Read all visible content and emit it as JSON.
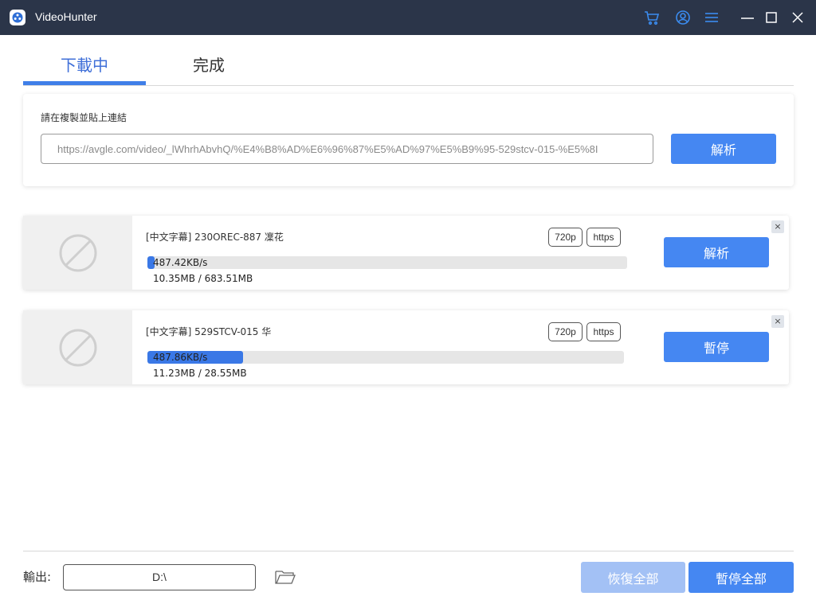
{
  "app": {
    "title": "VideoHunter",
    "icons": [
      "cart-icon",
      "account-icon",
      "menu-icon",
      "minimize-icon",
      "maximize-icon",
      "close-icon"
    ]
  },
  "tabs": [
    {
      "label": "下載中",
      "active": true
    },
    {
      "label": "完成",
      "active": false
    }
  ],
  "url_panel": {
    "label": "請在複製並貼上連結",
    "value": "https://avgle.com/video/_lWhrhAbvhQ/%E4%B8%AD%E6%96%87%E5%AD%97%E5%B9%95-529stcv-015-%E5%8I",
    "button": "解析"
  },
  "downloads": [
    {
      "title": "[中文字幕] 230OREC-887 凜花",
      "quality": "720p",
      "protocol": "https",
      "speed": "487.42KB/s",
      "size": "10.35MB / 683.51MB",
      "progress": 0.0151,
      "button": "解析"
    },
    {
      "title": "[中文字幕] 529STCV-015 华",
      "quality": "720p",
      "protocol": "https",
      "speed": "487.86KB/s",
      "size": "11.23MB / 28.55MB",
      "progress": 0.2,
      "button": "暫停"
    }
  ],
  "footer": {
    "output_label": "輸出:",
    "output_path": "D:\\",
    "resume_all": "恢復全部",
    "pause_all": "暫停全部"
  },
  "colors": {
    "titlebar": "#2b3549",
    "accent": "#4587f2",
    "accent_disabled": "#a3c1f5",
    "progress": "#3a78e6",
    "tab_active_text": "#3f6fd8"
  }
}
